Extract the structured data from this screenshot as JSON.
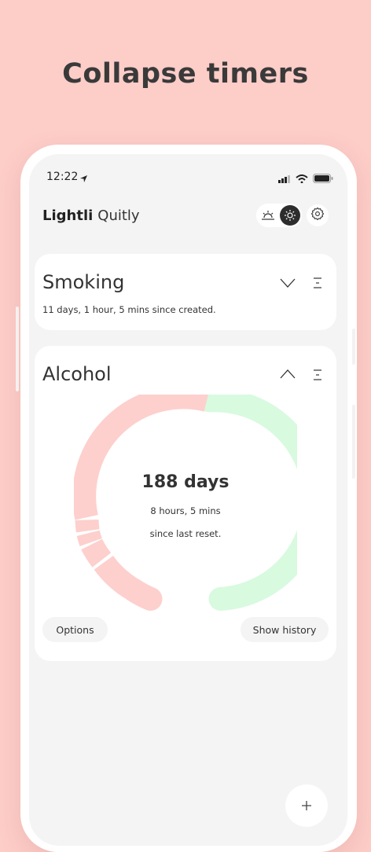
{
  "headline": "Collapse timers",
  "status_bar": {
    "time": "12:22"
  },
  "header": {
    "brand_bold": "Lightli",
    "brand_light": "Quitly"
  },
  "timers": [
    {
      "title": "Smoking",
      "subtitle": "11 days, 1 hour, 5 mins since created.",
      "expanded": false
    },
    {
      "title": "Alcohol",
      "expanded": true,
      "days_label": "188 days",
      "detail_line": "8 hours, 5 mins",
      "since_label": "since last reset.",
      "options_label": "Options",
      "history_label": "Show history"
    }
  ],
  "colors": {
    "background": "#fdcdc8",
    "progress_pink": "#fdd0cd",
    "progress_green": "#d8fadf",
    "card": "#ffffff",
    "screen": "#f4f4f4"
  },
  "icons": {
    "location": "location-arrow-icon",
    "signal": "signal-icon",
    "wifi": "wifi-icon",
    "battery": "battery-icon",
    "sunrise": "sunrise-icon",
    "sun": "sun-icon",
    "settings": "gear-icon",
    "chevron_down": "chevron-down-icon",
    "chevron_up": "chevron-up-icon",
    "menu": "menu-icon",
    "add": "plus-icon"
  }
}
